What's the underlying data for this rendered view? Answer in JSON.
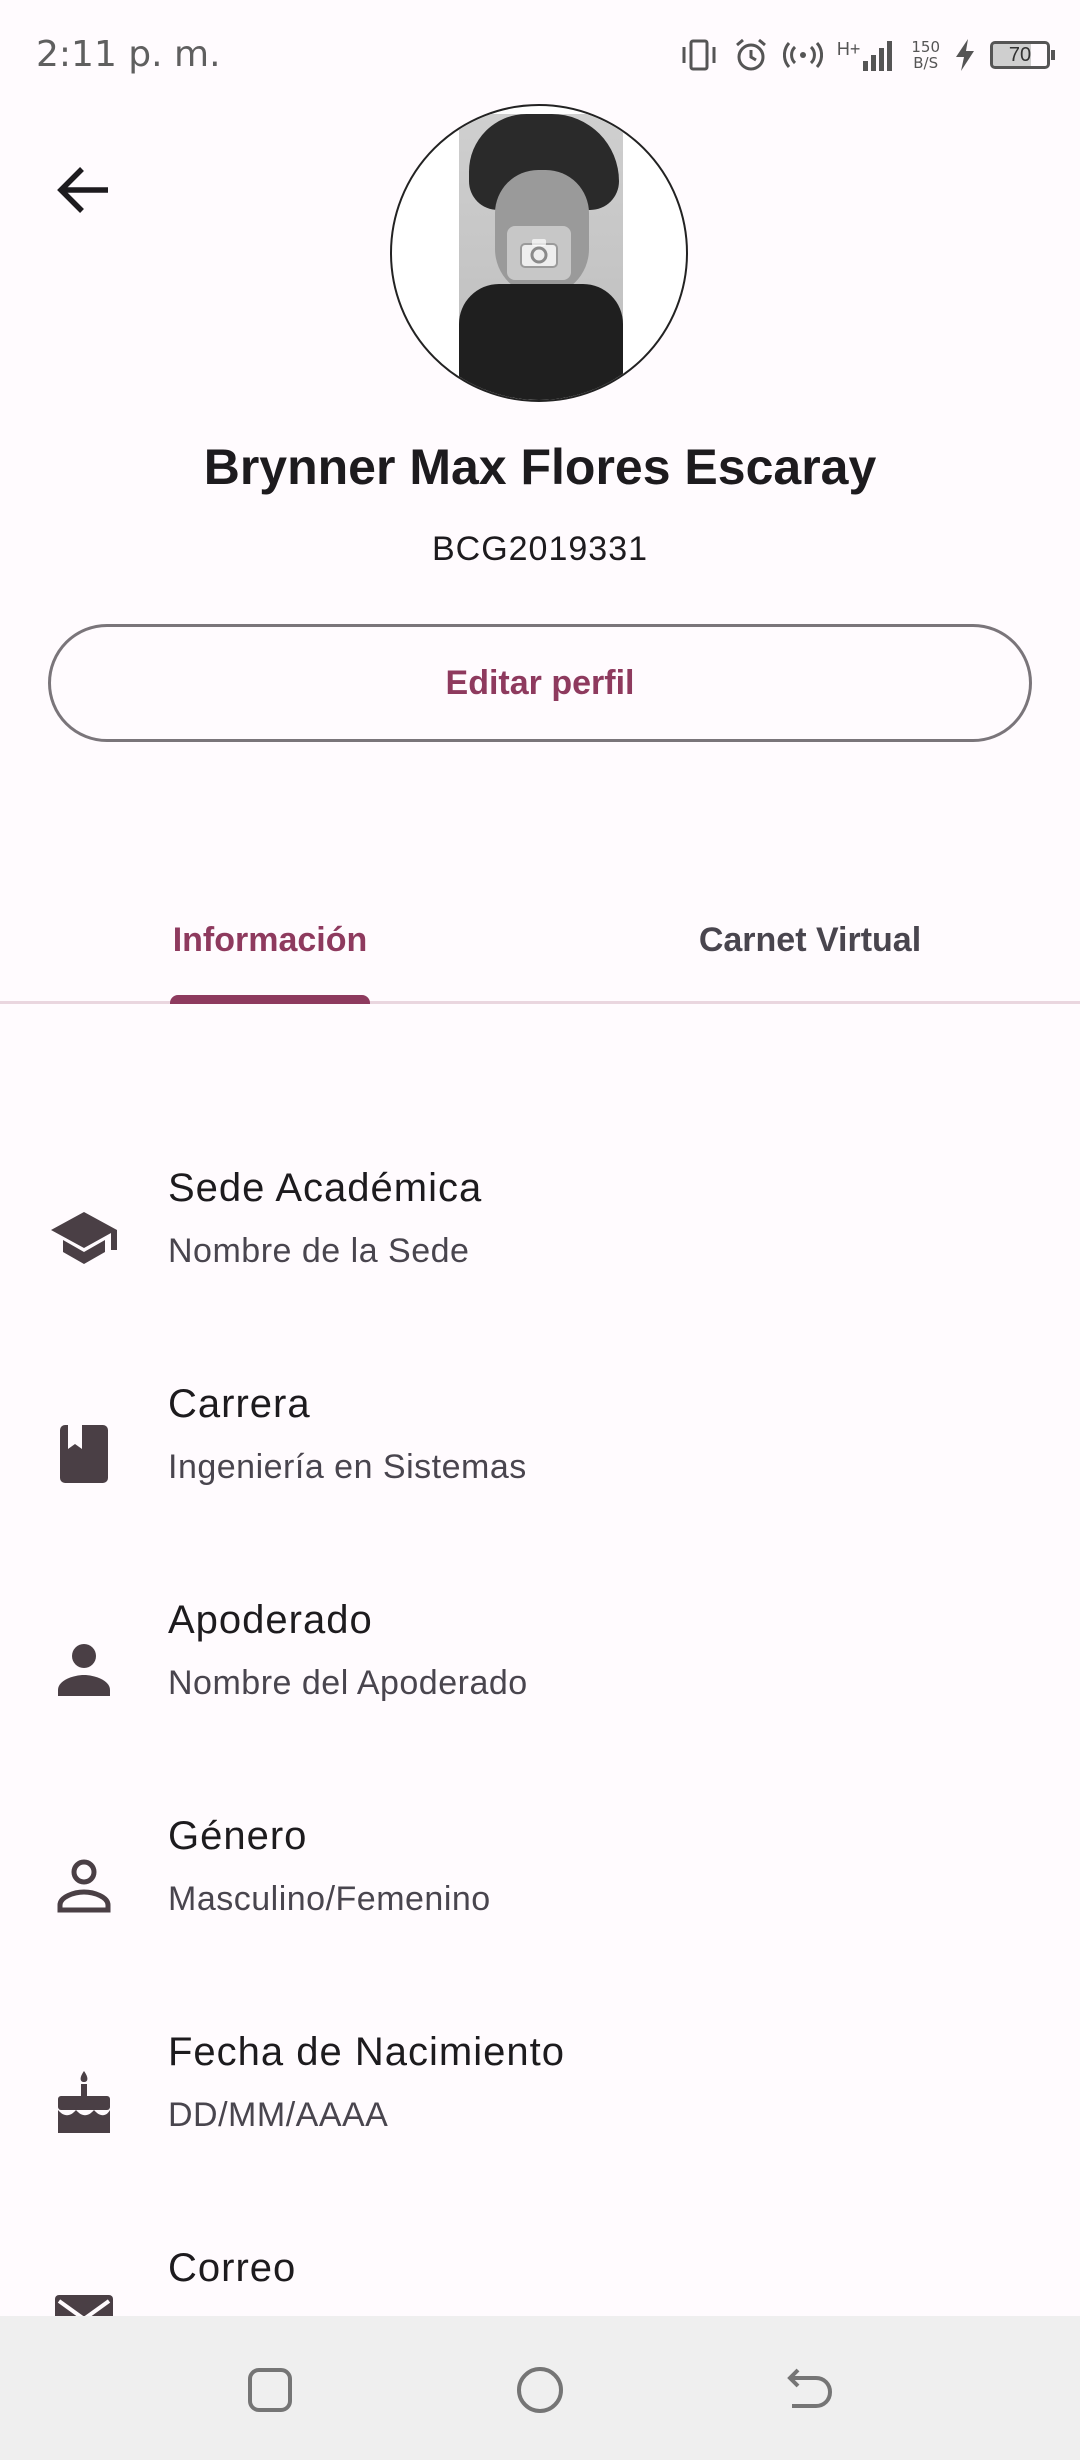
{
  "status_bar": {
    "time": "2:11 p. m.",
    "network_type": "H+",
    "speed_value": "150",
    "speed_unit": "B/S",
    "battery_level": "70"
  },
  "profile": {
    "name": "Brynner Max Flores Escaray",
    "code": "BCG2019331",
    "edit_label": "Editar perfil"
  },
  "tabs": [
    {
      "label": "Información",
      "selected": true
    },
    {
      "label": "Carnet Virtual",
      "selected": false
    }
  ],
  "info_items": [
    {
      "icon": "school-icon",
      "title": "Sede Académica",
      "value": "Nombre de la Sede"
    },
    {
      "icon": "book-icon",
      "title": "Carrera",
      "value": "Ingeniería en Sistemas"
    },
    {
      "icon": "person-icon",
      "title": "Apoderado",
      "value": "Nombre del Apoderado"
    },
    {
      "icon": "person-outline-icon",
      "title": "Género",
      "value": "Masculino/Femenino"
    },
    {
      "icon": "cake-icon",
      "title": "Fecha de Nacimiento",
      "value": "DD/MM/AAAA"
    },
    {
      "icon": "mail-icon",
      "title": "Correo",
      "value": ""
    }
  ],
  "colors": {
    "accent": "#8e3a5e",
    "icon": "#4a3f45",
    "background": "#fffbfe"
  },
  "nav_bar": {
    "buttons": [
      "recents-icon",
      "home-icon",
      "back-icon"
    ]
  }
}
